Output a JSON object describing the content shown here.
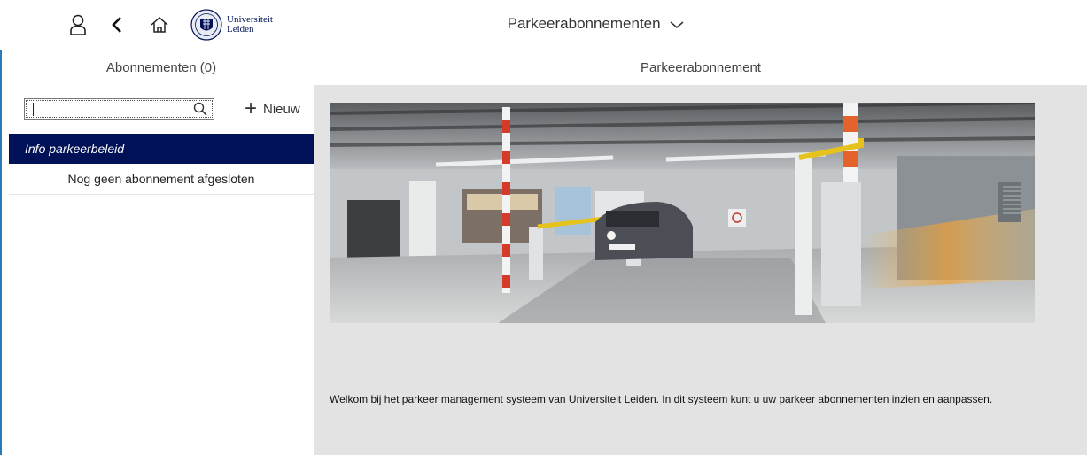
{
  "topbar": {
    "icons": [
      "user-icon",
      "back-icon",
      "home-icon"
    ],
    "logo_line1": "Universiteit",
    "logo_line2": "Leiden",
    "title": "Parkeerabonnementen"
  },
  "left_panel": {
    "header": "Abonnementen (0)",
    "search": {
      "value": "",
      "placeholder": ""
    },
    "new_label": "Nieuw",
    "items": [
      {
        "label": "Info parkeerbeleid",
        "selected": true
      },
      {
        "label": "Nog geen abonnement afgesloten",
        "selected": false
      }
    ]
  },
  "right_panel": {
    "header": "Parkeerabonnement",
    "welcome_text": "Welkom bij het parkeer management systeem van Universiteit Leiden. In dit systeem kunt u uw parkeer abonnementen inzien en aanpassen."
  },
  "colors": {
    "brand": "#001158",
    "content_bg": "#e3e3e3",
    "edge": "#2a7ab8"
  }
}
